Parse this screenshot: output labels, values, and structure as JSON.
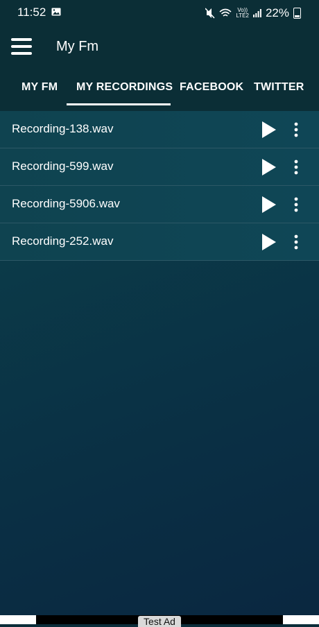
{
  "status_bar": {
    "time": "11:52",
    "battery": "22%",
    "volte": "Vo))",
    "lte": "LTE2"
  },
  "app_bar": {
    "title": "My Fm"
  },
  "tabs": [
    {
      "label": "MY FM",
      "selected": false
    },
    {
      "label": "MY RECORDINGS",
      "selected": true
    },
    {
      "label": "FACEBOOK",
      "selected": false
    },
    {
      "label": "TWITTER",
      "selected": false
    }
  ],
  "recordings": [
    {
      "name": "Recording-138.wav"
    },
    {
      "name": "Recording-599.wav"
    },
    {
      "name": "Recording-5906.wav"
    },
    {
      "name": "Recording-252.wav"
    }
  ],
  "ad": {
    "label": "Test Ad"
  },
  "colors": {
    "header_bg": "#0b2e36",
    "row_bg": "#0f4350",
    "accent": "#ffffff"
  }
}
